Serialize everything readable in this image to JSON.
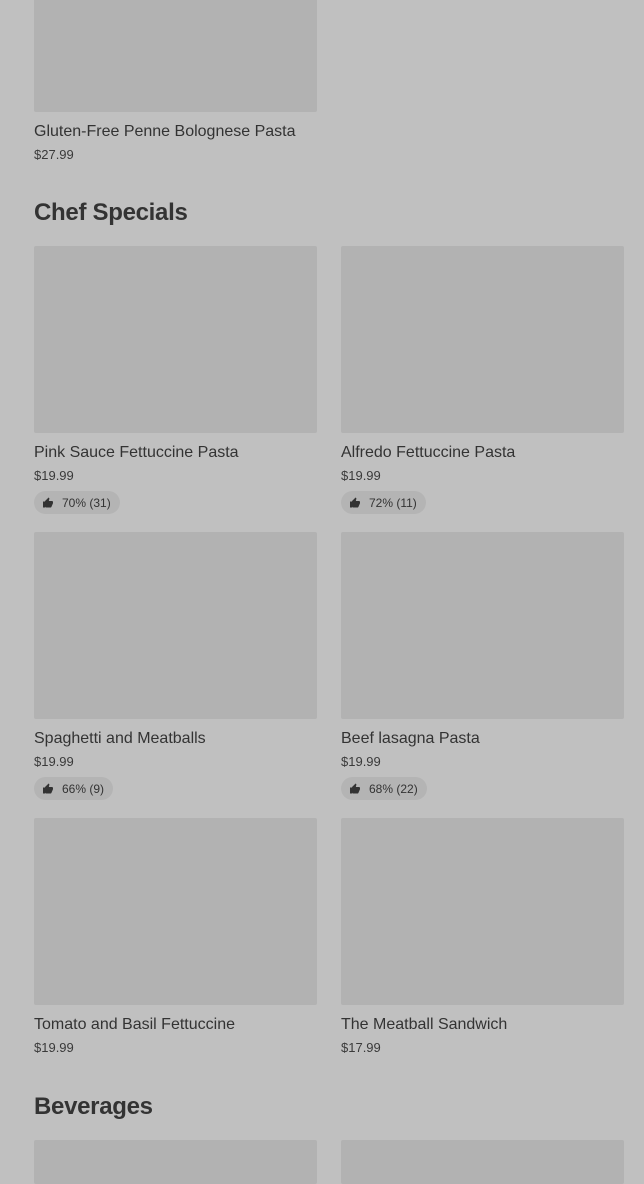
{
  "top_item": {
    "name": "Gluten-Free Penne Bolognese Pasta",
    "price": "$27.99"
  },
  "sections": [
    {
      "title": "Chef Specials",
      "items": [
        {
          "name": "Pink Sauce Fettuccine Pasta",
          "price": "$19.99",
          "rating": "70% (31)"
        },
        {
          "name": "Alfredo Fettuccine Pasta",
          "price": "$19.99",
          "rating": "72% (11)"
        },
        {
          "name": "Spaghetti and Meatballs",
          "price": "$19.99",
          "rating": "66% (9)"
        },
        {
          "name": "Beef lasagna Pasta",
          "price": "$19.99",
          "rating": "68% (22)"
        },
        {
          "name": "Tomato and Basil Fettuccine",
          "price": "$19.99"
        },
        {
          "name": "The Meatball Sandwich",
          "price": "$17.99"
        }
      ]
    },
    {
      "title": "Beverages"
    }
  ],
  "icons": {
    "rating": "thumbs-up-icon"
  }
}
